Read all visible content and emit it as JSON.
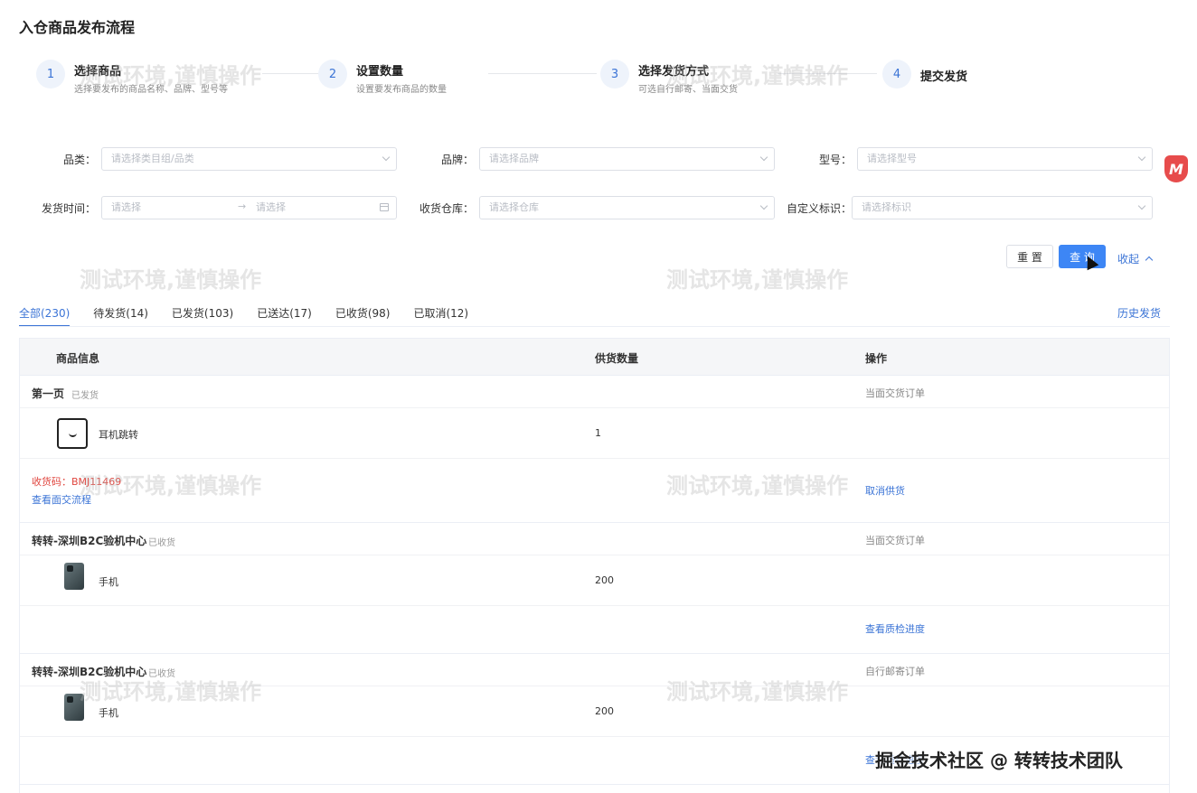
{
  "page_title": "入仓商品发布流程",
  "steps": [
    {
      "num": "1",
      "title": "选择商品",
      "desc": "选择要发布的商品名称、品牌、型号等"
    },
    {
      "num": "2",
      "title": "设置数量",
      "desc": "设置要发布商品的数量"
    },
    {
      "num": "3",
      "title": "选择发货方式",
      "desc": "可选自行邮寄、当面交货"
    },
    {
      "num": "4",
      "title": "提交发货",
      "desc": ""
    }
  ],
  "watermark_text": "测试环境,谨慎操作",
  "filters": {
    "category": {
      "label": "品类：",
      "placeholder": "请选择类目组/品类"
    },
    "brand": {
      "label": "品牌：",
      "placeholder": "请选择品牌"
    },
    "model": {
      "label": "型号：",
      "placeholder": "请选择型号"
    },
    "ship_time": {
      "label": "发货时间：",
      "start_placeholder": "请选择",
      "separator": "→",
      "end_placeholder": "请选择"
    },
    "warehouse": {
      "label": "收货仓库：",
      "placeholder": "请选择仓库"
    },
    "custom_tag": {
      "label": "自定义标识：",
      "placeholder": "请选择标识"
    }
  },
  "buttons": {
    "reset": "重 置",
    "query": "查 询",
    "collapse": "收起"
  },
  "tabs": [
    {
      "label": "全部(230)",
      "active": true
    },
    {
      "label": "待发货(14)",
      "active": false
    },
    {
      "label": "已发货(103)",
      "active": false
    },
    {
      "label": "已送达(17)",
      "active": false
    },
    {
      "label": "已收货(98)",
      "active": false
    },
    {
      "label": "已取消(12)",
      "active": false
    }
  ],
  "history_link": "历史发货",
  "table": {
    "headers": {
      "product": "商品信息",
      "qty": "供货数量",
      "action": "操作"
    },
    "groups": [
      {
        "name": "第一页",
        "status": "已发货",
        "order_type": "当面交货订单",
        "item": {
          "name": "耳机跳转",
          "qty": "1",
          "thumb": "bag"
        },
        "code_label": "收货码：BMJ11469",
        "flow_link": "查看面交流程",
        "action": "取消供货"
      },
      {
        "name": "转转-深圳B2C验机中心",
        "status": "已收货",
        "order_type": "当面交货订单",
        "item": {
          "name": "手机",
          "qty": "200",
          "thumb": "phone"
        },
        "action": "查看质检进度"
      },
      {
        "name": "转转-深圳B2C验机中心",
        "status": "已收货",
        "order_type": "自行邮寄订单",
        "item": {
          "name": "手机",
          "qty": "200",
          "thumb": "phone"
        },
        "action": "查看质检进度"
      }
    ]
  },
  "footer_credit": "掘金技术社区 @ 转转技术团队",
  "badge_letter": "M",
  "colors": {
    "primary": "#3d86f5",
    "link": "#3b74d6",
    "code_red": "#e0463f"
  }
}
